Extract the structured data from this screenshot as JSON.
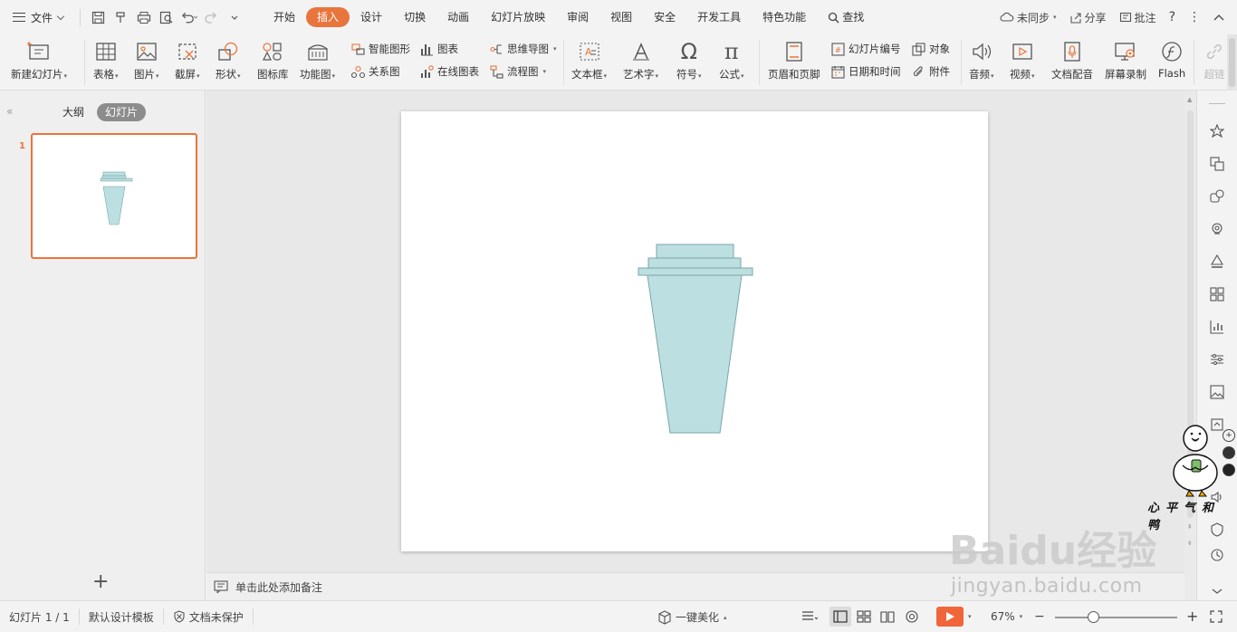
{
  "menubar": {
    "file_label": "文件",
    "tabs": [
      "开始",
      "插入",
      "设计",
      "切换",
      "动画",
      "幻灯片放映",
      "审阅",
      "视图",
      "安全",
      "开发工具",
      "特色功能"
    ],
    "active_tab": "插入",
    "search_label": "查找",
    "sync_label": "未同步",
    "share_label": "分享",
    "comment_label": "批注",
    "help_label": "?"
  },
  "ribbon": {
    "new_slide": "新建幻灯片",
    "table": "表格",
    "picture": "图片",
    "screenshot": "截屏",
    "shape": "形状",
    "icon_lib": "图标库",
    "func_chart": "功能图",
    "smart_art": "智能图形",
    "chart": "图表",
    "relation": "关系图",
    "online_chart": "在线图表",
    "mindmap": "思维导图",
    "flowchart": "流程图",
    "textbox": "文本框",
    "wordart": "艺术字",
    "symbol": "符号",
    "formula": "公式",
    "header_footer": "页眉和页脚",
    "slide_number": "幻灯片编号",
    "object": "对象",
    "date_time": "日期和时间",
    "attachment": "附件",
    "audio": "音频",
    "video": "视频",
    "doc_dub": "文档配音",
    "screen_rec": "屏幕录制",
    "flash": "Flash",
    "hyperlink": "超链"
  },
  "leftpanel": {
    "tab_outline": "大纲",
    "tab_slides": "幻灯片",
    "slide_number": "1"
  },
  "notes": {
    "placeholder": "单击此处添加备注"
  },
  "statusbar": {
    "slide_info": "幻灯片 1 / 1",
    "template": "默认设计模板",
    "protection": "文档未保护",
    "beautify": "一键美化",
    "zoom": "67%"
  },
  "watermark": {
    "logo": "Baidu经验",
    "url": "jingyan.baidu.com",
    "caption": "心平气和鸭"
  },
  "colors": {
    "accent": "#e8753c",
    "cup_fill": "#bcdfe1",
    "cup_stroke": "#7aa5a8"
  }
}
